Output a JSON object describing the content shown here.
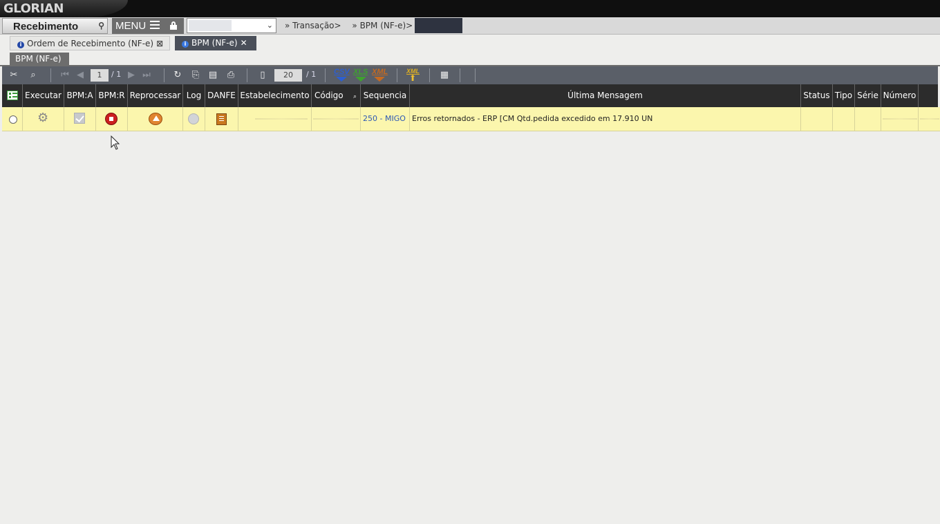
{
  "app": {
    "brand": "GLORIAN",
    "module": "Recebimento",
    "menu_label": "MENU"
  },
  "breadcrumbs": [
    "Transação>",
    "BPM (NF-e)>"
  ],
  "tabs": [
    {
      "label": "Ordem de Recebimento (NF-e)",
      "active": false
    },
    {
      "label": "BPM (NF-e)",
      "active": true
    }
  ],
  "subtab": {
    "label": "BPM (NF-e)"
  },
  "toolbar": {
    "page_current": "1",
    "page_total": "/ 1",
    "page_size": "20",
    "size_total": "/ 1",
    "export_csv": "CSV",
    "export_xls": "XLS",
    "export_xml": "XML",
    "import_xml": "XML"
  },
  "table": {
    "columns": [
      "Executar",
      "BPM:A",
      "BPM:R",
      "Reprocessar",
      "Log",
      "DANFE",
      "Estabelecimento",
      "Código",
      "Sequencia",
      "Última Mensagem",
      "Status",
      "Tipo",
      "Série",
      "Número"
    ],
    "rows": [
      {
        "sequencia": "250 - MIGO",
        "ultima_mensagem": "Erros retornados - ERP [CM Qtd.pedida excedido em 17.910 UN"
      }
    ]
  },
  "colors": {
    "row_highlight": "#fbf6ad",
    "header_bg": "#2c2c2c",
    "toolbar_bg": "#5a5f68",
    "link": "#2d58b5"
  }
}
